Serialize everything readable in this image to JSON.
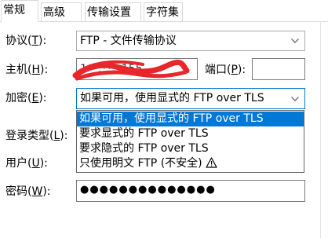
{
  "tabs": [
    {
      "label": "常规",
      "active": true
    },
    {
      "label": "高级",
      "active": false
    },
    {
      "label": "传输设置",
      "active": false
    },
    {
      "label": "字符集",
      "active": false
    }
  ],
  "form": {
    "protocol": {
      "label": "协议(",
      "key": "T",
      "suffix": "):",
      "value": "FTP - 文件传输协议"
    },
    "host": {
      "label": "主机(",
      "key": "H",
      "suffix": "):",
      "value": "1**.***.155"
    },
    "port": {
      "label": "端口(",
      "key": "P",
      "suffix": "):",
      "value": ""
    },
    "encryption": {
      "label": "加密(",
      "key": "E",
      "suffix": "):",
      "value": "如果可用，使用显式的 FTP over TLS"
    },
    "login_type": {
      "label": "登录类型(",
      "key": "L",
      "suffix": "):"
    },
    "user": {
      "label": "用户(",
      "key": "U",
      "suffix": "):"
    },
    "password": {
      "label": "密码(",
      "key": "W",
      "suffix": "):",
      "value": "●●●●●●●●●●●●●●"
    }
  },
  "encryption_options": [
    {
      "label": "如果可用，使用显式的 FTP over TLS",
      "selected": true
    },
    {
      "label": "要求显式的 FTP over TLS",
      "selected": false
    },
    {
      "label": "要求隐式的 FTP over TLS",
      "selected": false
    },
    {
      "label": "只使用明文 FTP (不安全)",
      "selected": false,
      "icon": "warning-icon"
    }
  ],
  "colors": {
    "accent": "#0078d7",
    "redaction": "#e8262b"
  }
}
